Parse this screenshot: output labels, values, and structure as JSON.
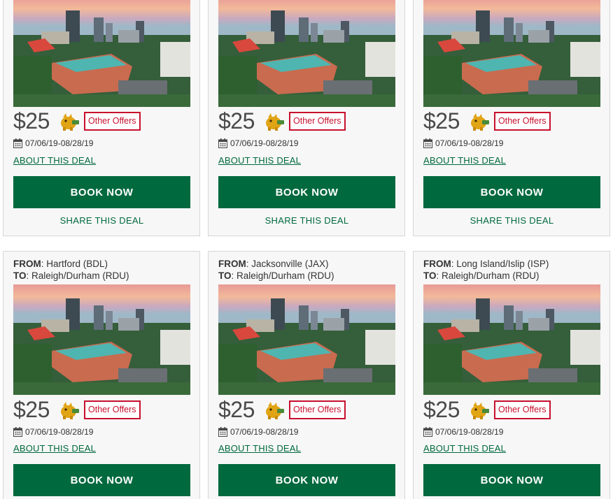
{
  "colors": {
    "brand_green": "#00693e",
    "offer_red": "#c8102e",
    "card_bg": "#f7f7f7"
  },
  "deals": [
    {
      "from_label": "",
      "from_value": "",
      "to_label": "",
      "to_value": "",
      "price": "$25",
      "offers_label": "Other Offers",
      "dates": "07/06/19-08/28/19",
      "about_label": "ABOUT THIS DEAL",
      "book_label": "BOOK NOW",
      "share_label": "SHARE THIS DEAL"
    },
    {
      "from_label": "",
      "from_value": "",
      "to_label": "",
      "to_value": "",
      "price": "$25",
      "offers_label": "Other Offers",
      "dates": "07/06/19-08/28/19",
      "about_label": "ABOUT THIS DEAL",
      "book_label": "BOOK NOW",
      "share_label": "SHARE THIS DEAL"
    },
    {
      "from_label": "",
      "from_value": "",
      "to_label": "",
      "to_value": "",
      "price": "$25",
      "offers_label": "Other Offers",
      "dates": "07/06/19-08/28/19",
      "about_label": "ABOUT THIS DEAL",
      "book_label": "BOOK NOW",
      "share_label": "SHARE THIS DEAL"
    },
    {
      "from_label": "FROM",
      "from_value": ": Hartford (BDL)",
      "to_label": "TO",
      "to_value": ": Raleigh/Durham (RDU)",
      "price": "$25",
      "offers_label": "Other Offers",
      "dates": "07/06/19-08/28/19",
      "about_label": "ABOUT THIS DEAL",
      "book_label": "BOOK NOW",
      "share_label": ""
    },
    {
      "from_label": "FROM",
      "from_value": ": Jacksonville (JAX)",
      "to_label": "TO",
      "to_value": ": Raleigh/Durham (RDU)",
      "price": "$25",
      "offers_label": "Other Offers",
      "dates": "07/06/19-08/28/19",
      "about_label": "ABOUT THIS DEAL",
      "book_label": "BOOK NOW",
      "share_label": ""
    },
    {
      "from_label": "FROM",
      "from_value": ": Long Island/Islip (ISP)",
      "to_label": "TO",
      "to_value": ": Raleigh/Durham (RDU)",
      "price": "$25",
      "offers_label": "Other Offers",
      "dates": "07/06/19-08/28/19",
      "about_label": "ABOUT THIS DEAL",
      "book_label": "BOOK NOW",
      "share_label": ""
    }
  ],
  "icons": {
    "mascot": "piggy-bank-mascot-icon",
    "calendar": "calendar-icon"
  }
}
